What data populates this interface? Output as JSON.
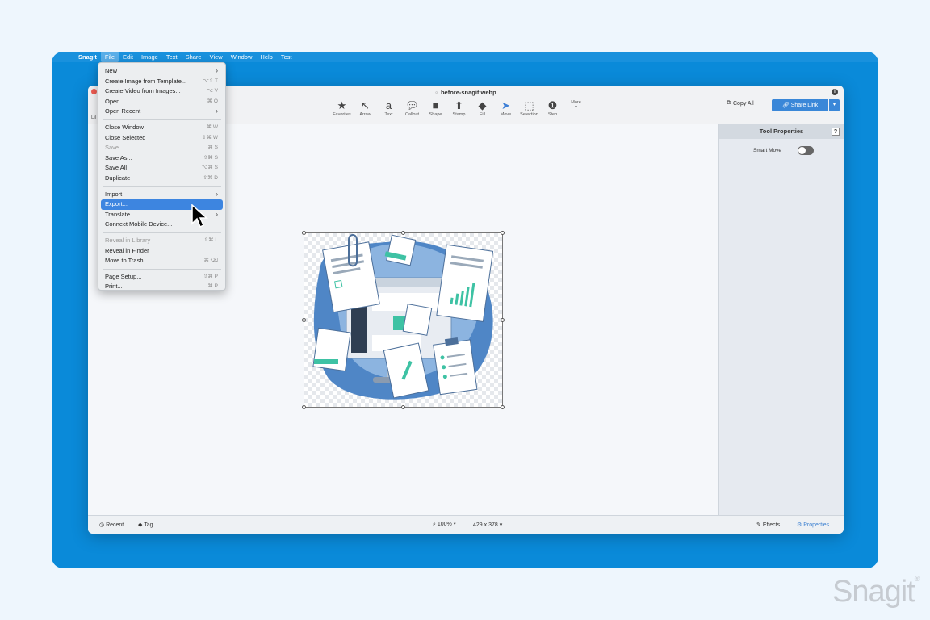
{
  "menubar": {
    "app_name": "Snagit",
    "items": [
      "File",
      "Edit",
      "Image",
      "Text",
      "Share",
      "View",
      "Window",
      "Help",
      "Test"
    ]
  },
  "window": {
    "title": "before-snagit.webp",
    "left_stub": "Lil"
  },
  "toolbar": {
    "tools": [
      {
        "label": "Favorites",
        "icon": "star-icon"
      },
      {
        "label": "Arrow",
        "icon": "arrow-icon"
      },
      {
        "label": "Text",
        "icon": "text-icon"
      },
      {
        "label": "Callout",
        "icon": "callout-icon"
      },
      {
        "label": "Shape",
        "icon": "shape-icon"
      },
      {
        "label": "Stamp",
        "icon": "stamp-icon"
      },
      {
        "label": "Fill",
        "icon": "fill-icon"
      },
      {
        "label": "Move",
        "icon": "move-icon"
      },
      {
        "label": "Selection",
        "icon": "selection-icon"
      },
      {
        "label": "Step",
        "icon": "step-icon"
      }
    ],
    "more_label": "More",
    "copy_all": "Copy All",
    "share_link": "Share Link"
  },
  "file_menu": {
    "items": [
      {
        "label": "New",
        "shortcut": "",
        "submenu": true,
        "disabled": false
      },
      {
        "label": "Create Image from Template...",
        "shortcut": "⌥⇧ T",
        "submenu": false,
        "disabled": false
      },
      {
        "label": "Create Video from Images...",
        "shortcut": "⌥ V",
        "submenu": false,
        "disabled": false
      },
      {
        "label": "Open...",
        "shortcut": "⌘ O",
        "submenu": false,
        "disabled": false
      },
      {
        "label": "Open Recent",
        "shortcut": "",
        "submenu": true,
        "disabled": false
      },
      {
        "sep": true
      },
      {
        "label": "Close Window",
        "shortcut": "⌘ W",
        "submenu": false,
        "disabled": false
      },
      {
        "label": "Close Selected",
        "shortcut": "⇧⌘ W",
        "submenu": false,
        "disabled": false
      },
      {
        "label": "Save",
        "shortcut": "⌘ S",
        "submenu": false,
        "disabled": true
      },
      {
        "label": "Save As...",
        "shortcut": "⇧⌘ S",
        "submenu": false,
        "disabled": false
      },
      {
        "label": "Save All",
        "shortcut": "⌥⌘ S",
        "submenu": false,
        "disabled": false
      },
      {
        "label": "Duplicate",
        "shortcut": "⇧⌘ D",
        "submenu": false,
        "disabled": false
      },
      {
        "sep": true
      },
      {
        "label": "Import",
        "shortcut": "",
        "submenu": true,
        "disabled": false
      },
      {
        "label": "Export...",
        "shortcut": "",
        "submenu": false,
        "disabled": false,
        "highlighted": true
      },
      {
        "label": "Translate",
        "shortcut": "",
        "submenu": true,
        "disabled": false
      },
      {
        "label": "Connect Mobile Device...",
        "shortcut": "",
        "submenu": false,
        "disabled": false
      },
      {
        "sep": true
      },
      {
        "label": "Reveal in Library",
        "shortcut": "⇧⌘ L",
        "submenu": false,
        "disabled": true
      },
      {
        "label": "Reveal in Finder",
        "shortcut": "",
        "submenu": false,
        "disabled": false
      },
      {
        "label": "Move to Trash",
        "shortcut": "⌘ ⌫",
        "submenu": false,
        "disabled": false
      },
      {
        "sep": true
      },
      {
        "label": "Page Setup...",
        "shortcut": "⇧⌘ P",
        "submenu": false,
        "disabled": false
      },
      {
        "label": "Print...",
        "shortcut": "⌘ P",
        "submenu": false,
        "disabled": false
      }
    ]
  },
  "properties": {
    "title": "Tool Properties",
    "help": "?",
    "smart_move": "Smart Move"
  },
  "status": {
    "recent": "Recent",
    "tag": "Tag",
    "zoom": "100%",
    "size": "429 x 378",
    "effects": "Effects",
    "properties": "Properties"
  },
  "watermark": "Snagit",
  "colors": {
    "accent": "#3a87d8",
    "desktop": "#0a8ad9",
    "highlight": "#3d85e0"
  }
}
